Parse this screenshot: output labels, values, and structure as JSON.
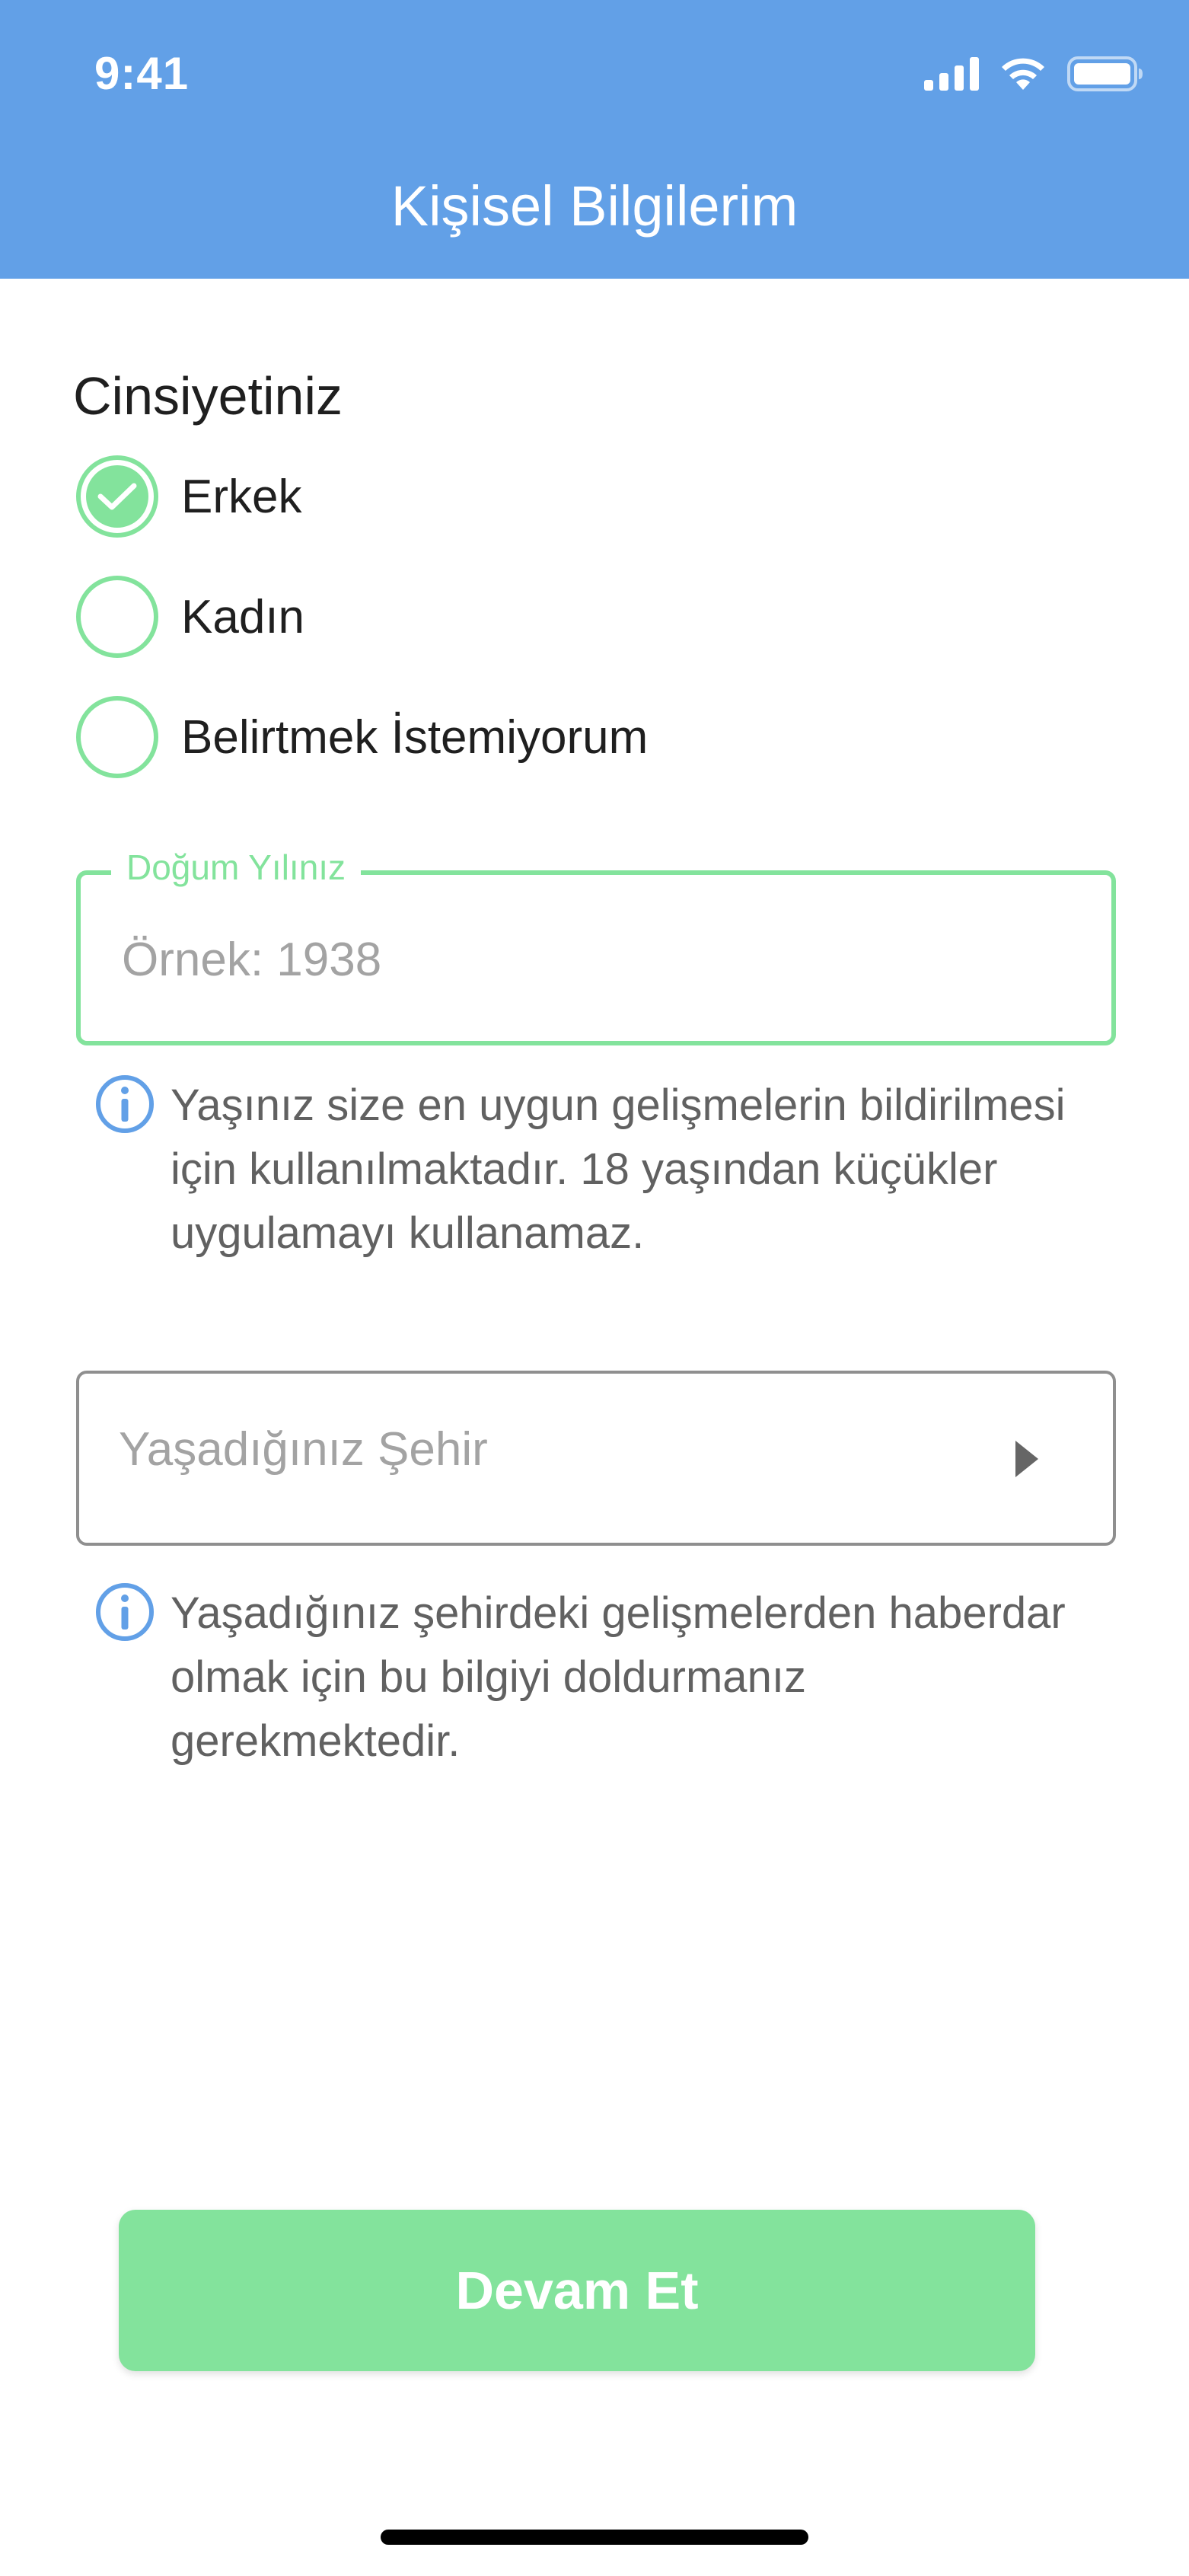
{
  "status_bar": {
    "time": "9:41"
  },
  "header": {
    "title": "Kişisel Bilgilerim",
    "background_color": "#62a0e7"
  },
  "gender": {
    "title": "Cinsiyetiniz",
    "options": [
      {
        "label": "Erkek",
        "selected": true
      },
      {
        "label": "Kadın",
        "selected": false
      },
      {
        "label": "Belirtmek İstemiyorum",
        "selected": false
      }
    ]
  },
  "birth_year": {
    "label": "Doğum Yılınız",
    "placeholder": "Örnek: 1938",
    "value": "",
    "info": "Yaşınız size en uygun gelişmelerin bildirilmesi için kullanılmaktadır. 18 yaşından küçükler uygulamayı kullanamaz."
  },
  "city": {
    "placeholder": "Yaşadığınız Şehir",
    "info": "Yaşadığınız şehirdeki gelişmelerden haberdar olmak için bu bilgiyi doldurmanız gerekmektedir."
  },
  "continue_button": {
    "label": "Devam Et"
  },
  "colors": {
    "accent_green": "#83e39c",
    "info_blue": "#62a0e7",
    "text_dark": "#1f1f1f",
    "text_muted": "#616161",
    "placeholder": "#a3a3a3"
  },
  "icons": {
    "signal": "cellular-signal-icon",
    "wifi": "wifi-icon",
    "battery": "battery-icon",
    "check": "checkmark-icon",
    "info": "info-icon",
    "arrow": "triangle-right-icon"
  }
}
